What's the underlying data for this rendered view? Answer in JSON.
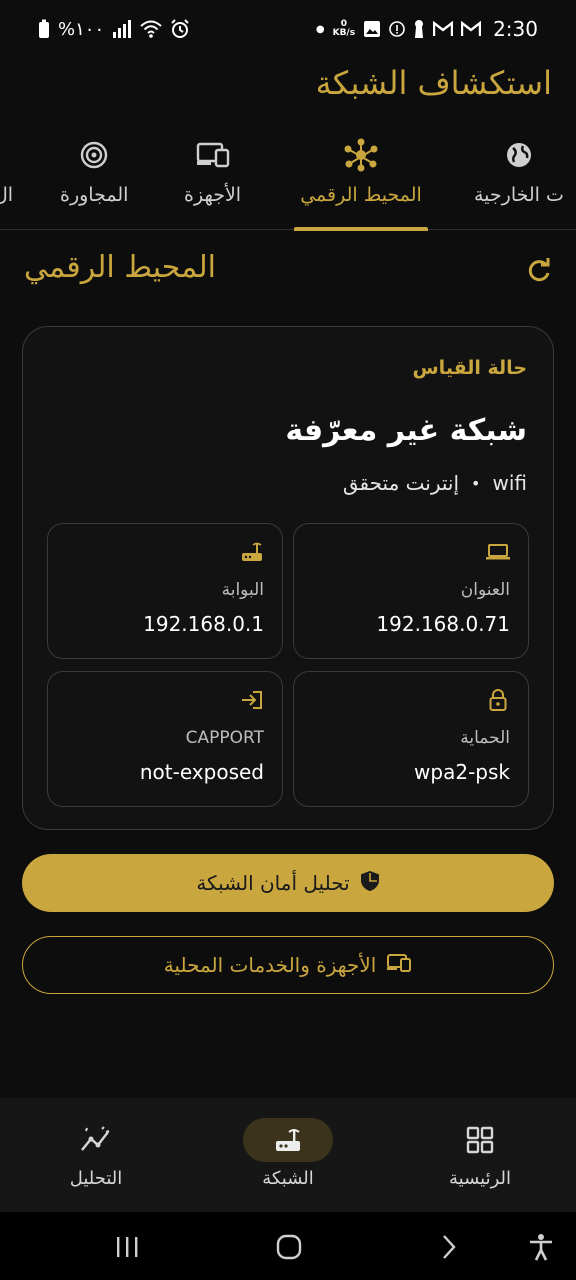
{
  "status_bar": {
    "battery_text": "%١٠٠",
    "time": "2:30",
    "speed_value": "0",
    "speed_unit": "KB/s"
  },
  "app": {
    "title": "استكشاف الشبكة"
  },
  "tabs": [
    {
      "label": "ت الخارجية",
      "icon": "globe-icon"
    },
    {
      "label": "المحيط الرقمي",
      "icon": "hub-icon",
      "active": true
    },
    {
      "label": "الأجهزة",
      "icon": "devices-icon"
    },
    {
      "label": "المجاورة",
      "icon": "radar-icon"
    },
    {
      "label": "ال",
      "icon": ""
    }
  ],
  "section": {
    "title": "المحيط الرقمي"
  },
  "card": {
    "label": "حالة القياس",
    "network_name": "شبكة غير معرّفة",
    "connection_type": "wifi",
    "internet_status": "إنترنت متحقق",
    "tiles": {
      "address": {
        "label": "العنوان",
        "value": "192.168.0.71",
        "icon": "laptop-icon"
      },
      "gateway": {
        "label": "البوابة",
        "value": "192.168.0.1",
        "icon": "router-icon"
      },
      "security": {
        "label": "الحماية",
        "value": "wpa2-psk",
        "icon": "lock-icon"
      },
      "capport": {
        "label": "CAPPORT",
        "value": "not-exposed",
        "icon": "login-icon"
      }
    }
  },
  "buttons": {
    "security_analysis": "تحليل أمان الشبكة",
    "devices_services": "الأجهزة والخدمات المحلية"
  },
  "bottom_nav": [
    {
      "label": "الرئيسية",
      "icon": "grid-icon"
    },
    {
      "label": "الشبكة",
      "icon": "router-icon",
      "active": true
    },
    {
      "label": "التحليل",
      "icon": "analytics-icon"
    }
  ],
  "colors": {
    "accent": "#c9a63e",
    "background": "#0d0d0d"
  }
}
